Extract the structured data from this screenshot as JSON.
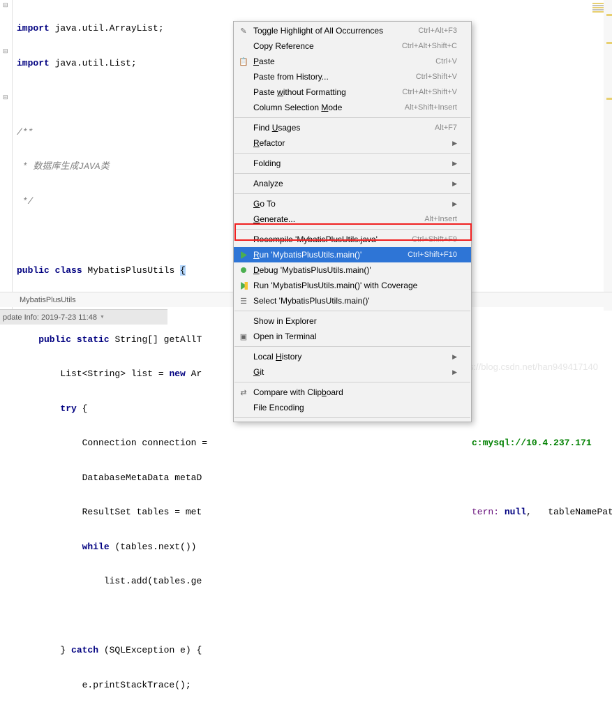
{
  "code": {
    "l1": "import java.util.ArrayList;",
    "l2": "import java.util.List;",
    "l4": "/**",
    "l5": " * 数据库生成JAVA类",
    "l6": " */",
    "l7_pub": "public ",
    "l7_cls": "class ",
    "l7_name": "MybatisPlusUtils ",
    "l7_brace": "{",
    "l9_ps": "    public static ",
    "l9_rest": "String[] getAllT",
    "l10": "        List<String> list = new Ar",
    "l11_try": "        try ",
    "l11_b": "{",
    "l12": "            Connection connection =",
    "l12_tail": "c:mysql://10.4.237.171",
    "l13": "            DatabaseMetaData metaD",
    "l14": "            ResultSet tables = met",
    "l14_tail_a": "tern: ",
    "l14_tail_b": "null",
    "l14_tail_c": ",   tableNamePatt",
    "l15_while": "            while ",
    "l15_rest": "(tables.next()) ",
    "l16": "                list.add(tables.ge",
    "l18_a": "        } ",
    "l18_catch": "catch ",
    "l18_b": "(SQLException e) {",
    "l19": "            e.printStackTrace();"
  },
  "menu": {
    "toggle": "Toggle Highlight of All Occurrences",
    "toggle_sc": "Ctrl+Alt+F3",
    "copyref": "Copy Reference",
    "copyref_sc": "Ctrl+Alt+Shift+C",
    "paste": "aste",
    "paste_sc": "Ctrl+V",
    "paste_hist": "Paste from History...",
    "paste_hist_sc": "Ctrl+Shift+V",
    "paste_fmt_a": "Paste ",
    "paste_fmt_b": "ithout Formatting",
    "paste_fmt_sc": "Ctrl+Alt+Shift+V",
    "col_a": "Column Selection ",
    "col_b": "ode",
    "col_sc": "Alt+Shift+Insert",
    "find_a": "Find ",
    "find_b": "sages",
    "find_sc": "Alt+F7",
    "refactor": "efactor",
    "folding": "Folding",
    "analyze": "Analyze",
    "goto": "o To",
    "generate": "enerate...",
    "generate_sc": "Alt+Insert",
    "recompile": "Recompile 'MybatisPlusUtils.java'",
    "recompile_sc": "Ctrl+Shift+F9",
    "run": "un 'MybatisPlusUtils.main()'",
    "run_sc": "Ctrl+Shift+F10",
    "debug": "ebug 'MybatisPlusUtils.main()'",
    "coverage": "Run 'MybatisPlusUtils.main()' with Coverage",
    "select": "Select 'MybatisPlusUtils.main()'",
    "explorer": "Show in Explorer",
    "terminal": "Open in Terminal",
    "local_hist": "Local ",
    "local_hist_b": "istory",
    "git": "it",
    "compare": "Compare with Clip",
    "compare_b": "oard",
    "encoding": "File Encoding"
  },
  "breadcrumb": {
    "item": "MybatisPlusUtils"
  },
  "status": {
    "text": "pdate Info: 2019-7-23 11:48"
  },
  "watermark": "https://blog.csdn.net/han949417140"
}
